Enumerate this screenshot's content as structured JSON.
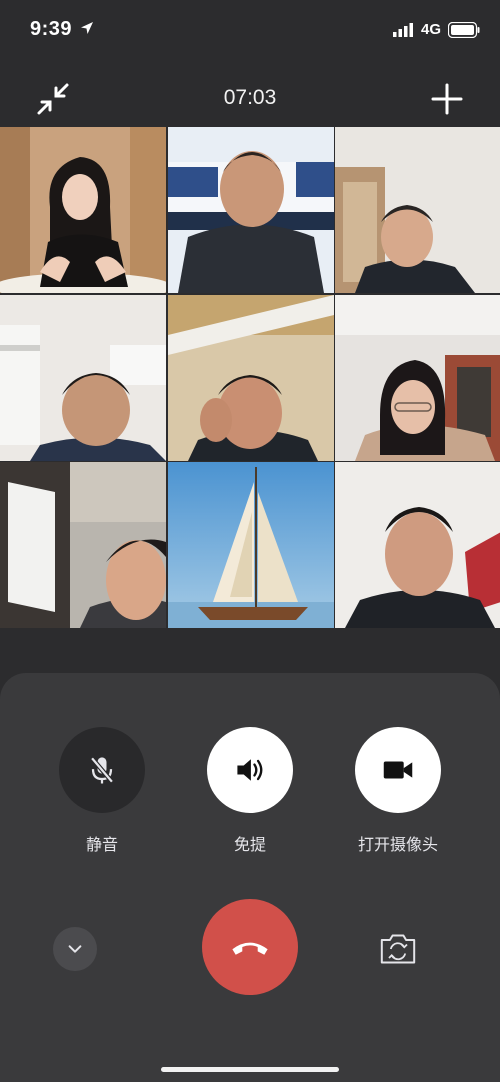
{
  "status": {
    "time": "9:39",
    "network": "4G"
  },
  "call": {
    "duration": "07:03"
  },
  "participants": [
    {
      "icon": "participant-1-video"
    },
    {
      "icon": "participant-2-video"
    },
    {
      "icon": "participant-3-video"
    },
    {
      "icon": "participant-4-video"
    },
    {
      "icon": "participant-5-video"
    },
    {
      "icon": "participant-6-video"
    },
    {
      "icon": "participant-7-video"
    },
    {
      "icon": "participant-8-sailboat-avatar"
    },
    {
      "icon": "participant-9-video"
    }
  ],
  "controls": {
    "mute_label": "静音",
    "speaker_label": "免提",
    "camera_label": "打开摄像头"
  },
  "colors": {
    "hangup": "#d1504a",
    "background": "#2c2c2e",
    "panel": "#3a3a3c"
  }
}
